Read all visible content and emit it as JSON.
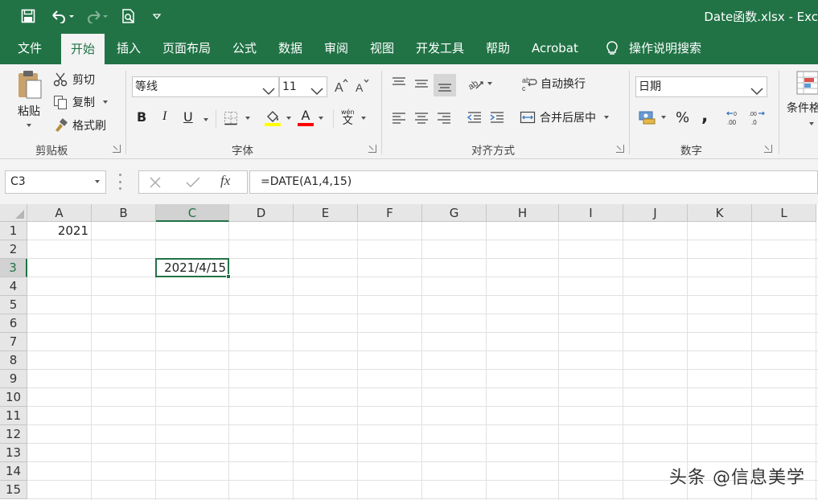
{
  "window": {
    "title": "Date函数.xlsx  -  Exc"
  },
  "tabs": [
    {
      "label": "文件"
    },
    {
      "label": "开始"
    },
    {
      "label": "插入"
    },
    {
      "label": "页面布局"
    },
    {
      "label": "公式"
    },
    {
      "label": "数据"
    },
    {
      "label": "审阅"
    },
    {
      "label": "视图"
    },
    {
      "label": "开发工具"
    },
    {
      "label": "帮助"
    },
    {
      "label": "Acrobat"
    },
    {
      "label": "操作说明搜索"
    }
  ],
  "active_tab": "开始",
  "ribbon": {
    "clipboard": {
      "label": "剪贴板",
      "paste": "粘贴",
      "cut": "剪切",
      "copy": "复制",
      "format_painter": "格式刷"
    },
    "font": {
      "label": "字体",
      "font_name": "等线",
      "font_size": "11",
      "bold": "B",
      "italic": "I",
      "underline": "U",
      "font_color_letter": "A",
      "phonetic": "wén"
    },
    "alignment": {
      "label": "对齐方式",
      "wrap_text": "自动换行",
      "merge_center": "合并后居中"
    },
    "number": {
      "label": "数字",
      "format": "日期",
      "percent": "%",
      "comma": ","
    },
    "styles": {
      "conditional": "条件格"
    }
  },
  "formula_bar": {
    "name_box": "C3",
    "formula": "=DATE(A1,4,15)",
    "fx": "fx"
  },
  "sheet": {
    "columns": [
      "A",
      "B",
      "C",
      "D",
      "E",
      "F",
      "G",
      "H",
      "I",
      "J",
      "K",
      "L"
    ],
    "rows": [
      "1",
      "2",
      "3",
      "4",
      "5",
      "6",
      "7",
      "8",
      "9",
      "10",
      "11",
      "12",
      "13",
      "14",
      "15"
    ],
    "selected_cell": "C3",
    "cells": {
      "A1": "2021",
      "C3": "2021/4/15"
    }
  },
  "watermark": "头条 @信息美学",
  "colors": {
    "accent": "#217346",
    "ribbon_bg": "#f3f3f3",
    "header_bg": "#e6e6e6"
  }
}
